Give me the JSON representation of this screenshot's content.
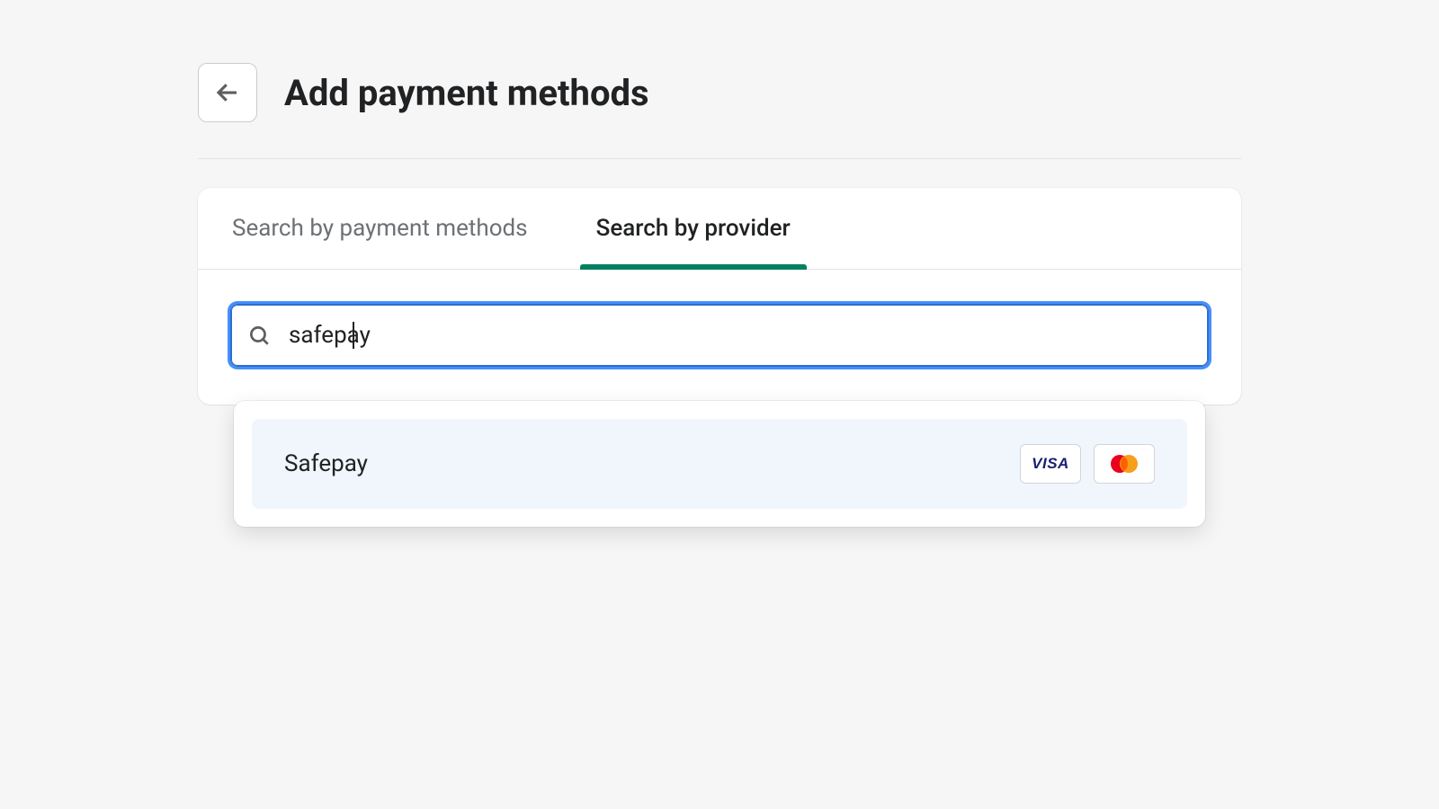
{
  "header": {
    "title": "Add payment methods"
  },
  "tabs": [
    {
      "label": "Search by payment methods",
      "active": false
    },
    {
      "label": "Search by provider",
      "active": true
    }
  ],
  "search": {
    "value": "safepay",
    "placeholder": ""
  },
  "results": [
    {
      "name": "Safepay",
      "cards": [
        "visa",
        "mastercard"
      ]
    }
  ],
  "card_labels": {
    "visa": "VISA",
    "mastercard": "mastercard"
  }
}
